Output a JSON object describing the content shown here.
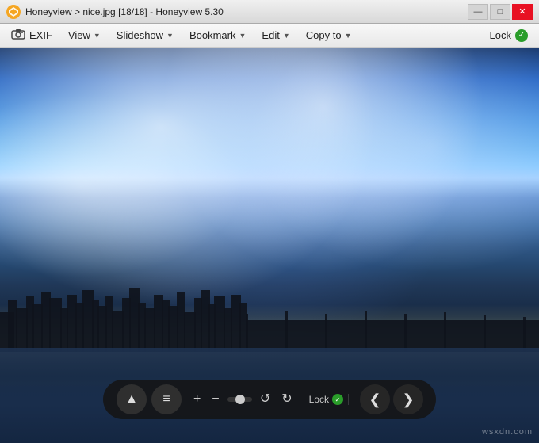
{
  "titlebar": {
    "app_name": "Honeyview",
    "separator1": ">",
    "file_name": "nice.jpg [18/18]",
    "app_version": "Honeyview 5.30",
    "full_title": "Honeyview > nice.jpg [18/18] - Honeyview 5.30",
    "minimize_label": "—",
    "maximize_label": "□",
    "close_label": "✕"
  },
  "menubar": {
    "exif_label": "EXIF",
    "view_label": "View",
    "slideshow_label": "Slideshow",
    "bookmark_label": "Bookmark",
    "edit_label": "Edit",
    "copyto_label": "Copy to",
    "lock_label": "Lock"
  },
  "toolbar": {
    "eject_label": "⏏",
    "menu_label": "≡",
    "zoom_in_label": "+",
    "zoom_out_label": "−",
    "rotate_left_label": "↺",
    "rotate_right_label": "↻",
    "lock_label": "Lock",
    "prev_label": "❮",
    "next_label": "❯"
  },
  "image": {
    "filename": "nice.jpg",
    "index": "18/18"
  },
  "watermark": {
    "text": "wsxdn.com"
  }
}
